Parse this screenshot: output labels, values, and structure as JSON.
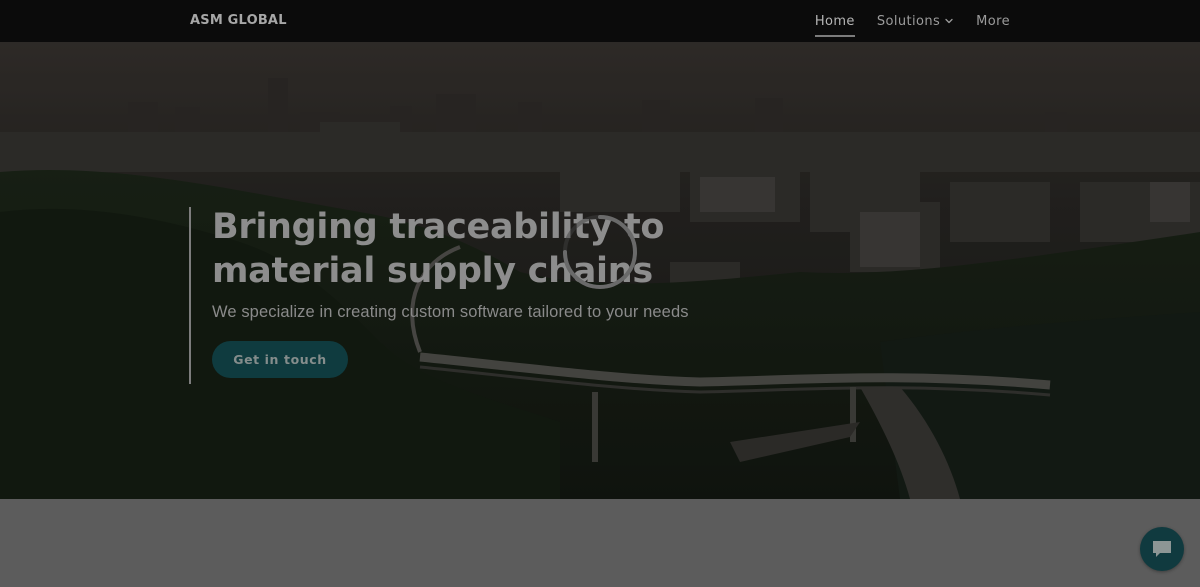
{
  "header": {
    "brand": "ASM GLOBAL",
    "nav": [
      {
        "label": "Home",
        "active": true
      },
      {
        "label": "Solutions",
        "icon": "chevron-down-icon"
      },
      {
        "label": "More"
      }
    ]
  },
  "hero": {
    "headline": "Bringing traceability to material supply chains",
    "subhead": "We specialize in creating custom software tailored to your needs",
    "cta_label": "Get in touch",
    "loading_icon": "loading-spinner-icon"
  },
  "chat": {
    "icon": "chat-bubble-icon"
  },
  "colors": {
    "header_bg": "#0b0b0b",
    "cta_bg": "#0f3b3f",
    "chat_bg": "#103a3f",
    "lower_bg": "#5c5c5c"
  }
}
